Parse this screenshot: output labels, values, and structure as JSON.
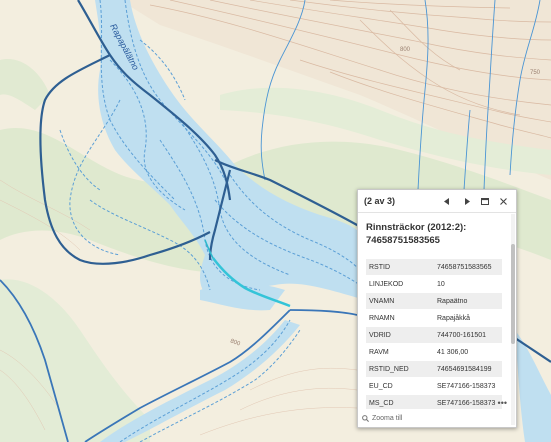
{
  "map": {
    "river_label": "Rapapälätno",
    "contour_labels": [
      "800",
      "750",
      "800"
    ]
  },
  "popup": {
    "counter": "(2 av 3)",
    "title": "Rinnsträckor (2012:2): 74658751583565",
    "rows": [
      {
        "key": "RSTID",
        "value": "74658751583565"
      },
      {
        "key": "LINJEKOD",
        "value": "10"
      },
      {
        "key": "VNAMN",
        "value": "Rapaätno"
      },
      {
        "key": "RNAMN",
        "value": "Rapajåkkå"
      },
      {
        "key": "VDRID",
        "value": "744700-161501"
      },
      {
        "key": "RAVM",
        "value": "41 306,00"
      },
      {
        "key": "RSTID_NED",
        "value": "74654691584199"
      },
      {
        "key": "EU_CD",
        "value": "SE747166-158373"
      },
      {
        "key": "MS_CD",
        "value": "SE747166-158373"
      }
    ],
    "zoom_label": "Zooma till",
    "more_label": "•••"
  },
  "icons": {
    "prev": "chevron-left-icon",
    "next": "chevron-right-icon",
    "dock": "dock-icon",
    "close": "close-icon",
    "zoom": "magnifier-icon"
  }
}
